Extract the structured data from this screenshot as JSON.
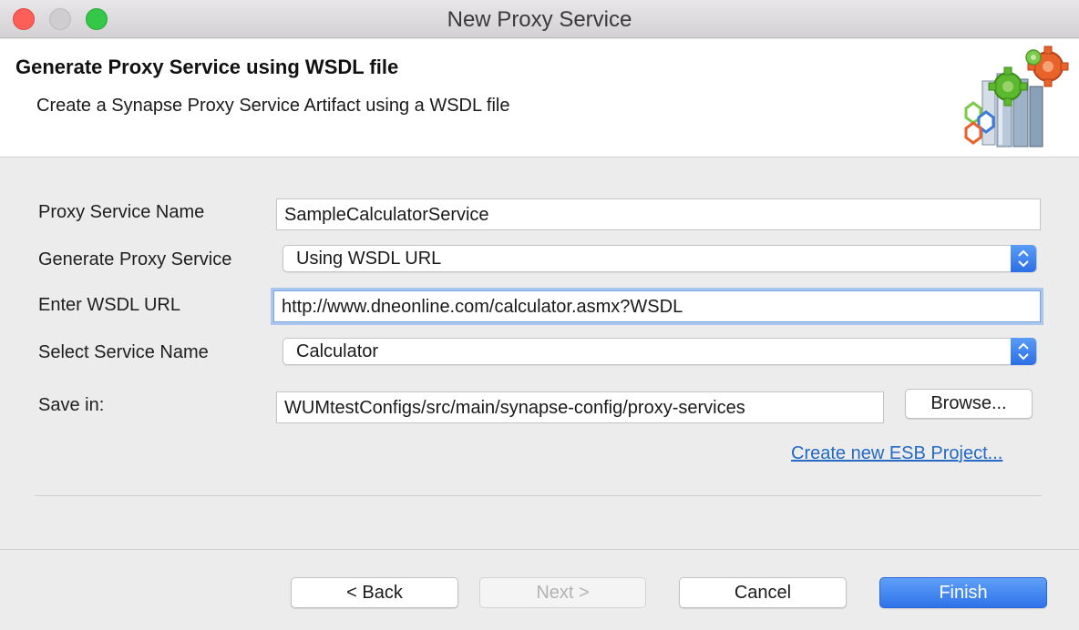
{
  "window": {
    "title": "New Proxy Service"
  },
  "header": {
    "title": "Generate Proxy Service using WSDL file",
    "subtitle": "Create a Synapse Proxy Service Artifact using a WSDL file",
    "banner_icon": "gears-and-columns-icon"
  },
  "form": {
    "proxy_name_label": "Proxy Service Name",
    "proxy_name_value": "SampleCalculatorService",
    "generate_label": "Generate Proxy Service",
    "generate_value": "Using WSDL URL",
    "wsdl_url_label": "Enter WSDL URL",
    "wsdl_url_value": "http://www.dneonline.com/calculator.asmx?WSDL",
    "service_name_label": "Select Service Name",
    "service_name_value": "Calculator",
    "save_in_label": "Save in:",
    "save_in_value": "WUMtestConfigs/src/main/synapse-config/proxy-services",
    "browse_label": "Browse...",
    "create_project_link": "Create new ESB Project..."
  },
  "footer": {
    "back_label": "< Back",
    "next_label": "Next >",
    "cancel_label": "Cancel",
    "finish_label": "Finish"
  },
  "colors": {
    "accent": "#2f73ea",
    "link": "#2369c5",
    "close": "#fc5f57",
    "maximize": "#34c748"
  }
}
